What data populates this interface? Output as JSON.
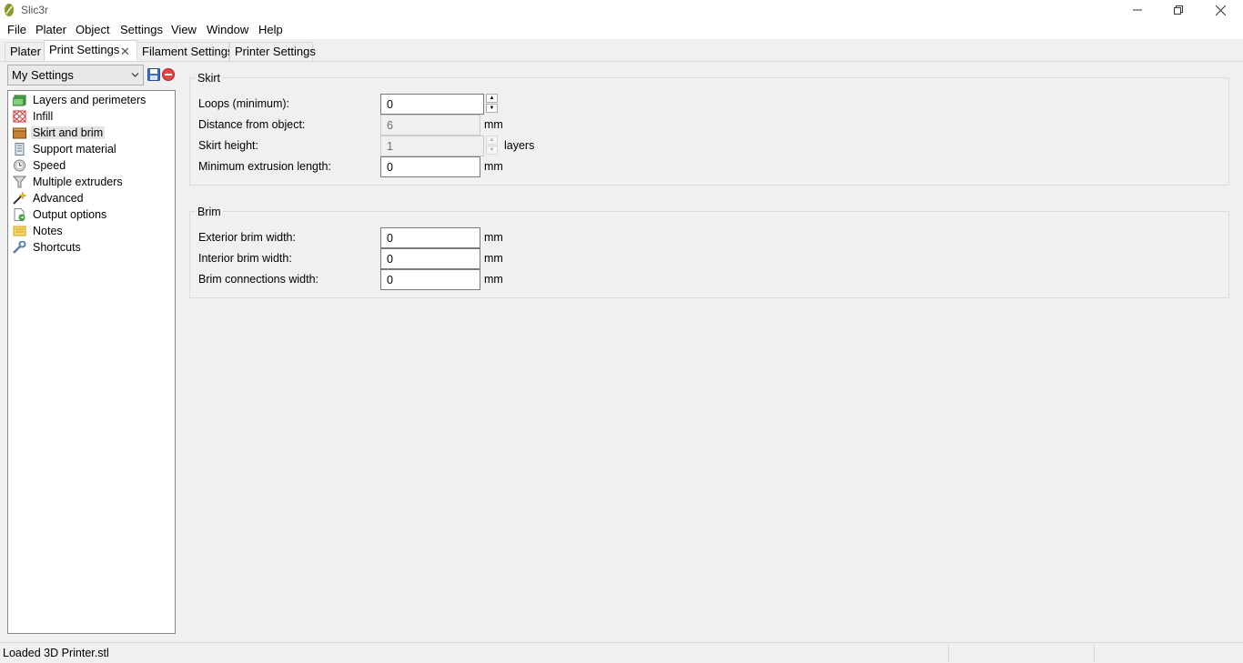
{
  "window": {
    "title": "Slic3r"
  },
  "menu": [
    "File",
    "Plater",
    "Object",
    "Settings",
    "View",
    "Window",
    "Help"
  ],
  "tabs": [
    {
      "label": "Plater",
      "active": false
    },
    {
      "label": "Print Settings",
      "active": true
    },
    {
      "label": "Filament Settings",
      "active": false
    },
    {
      "label": "Printer Settings",
      "active": false
    }
  ],
  "tab_close_glyph": "✕",
  "preset": {
    "selected": "My Settings"
  },
  "sidebar": {
    "items": [
      {
        "label": "Layers and perimeters",
        "icon": "layers-icon"
      },
      {
        "label": "Infill",
        "icon": "infill-icon"
      },
      {
        "label": "Skirt and brim",
        "icon": "box-icon",
        "selected": true
      },
      {
        "label": "Support material",
        "icon": "building-icon"
      },
      {
        "label": "Speed",
        "icon": "time-icon"
      },
      {
        "label": "Multiple extruders",
        "icon": "funnel-icon"
      },
      {
        "label": "Advanced",
        "icon": "wand-icon"
      },
      {
        "label": "Output options",
        "icon": "page-go-icon"
      },
      {
        "label": "Notes",
        "icon": "note-icon"
      },
      {
        "label": "Shortcuts",
        "icon": "wrench-icon"
      }
    ]
  },
  "skirt": {
    "title": "Skirt",
    "loops_label": "Loops (minimum):",
    "loops_value": "0",
    "distance_label": "Distance from object:",
    "distance_value": "6",
    "distance_unit": "mm",
    "height_label": "Skirt height:",
    "height_value": "1",
    "height_unit": "layers",
    "min_extrusion_label": "Minimum extrusion length:",
    "min_extrusion_value": "0",
    "min_extrusion_unit": "mm"
  },
  "brim": {
    "title": "Brim",
    "exterior_label": "Exterior brim width:",
    "exterior_value": "0",
    "exterior_unit": "mm",
    "interior_label": "Interior brim width:",
    "interior_value": "0",
    "interior_unit": "mm",
    "connections_label": "Brim connections width:",
    "connections_value": "0",
    "connections_unit": "mm"
  },
  "status": {
    "text": "Loaded 3D Printer.stl"
  }
}
